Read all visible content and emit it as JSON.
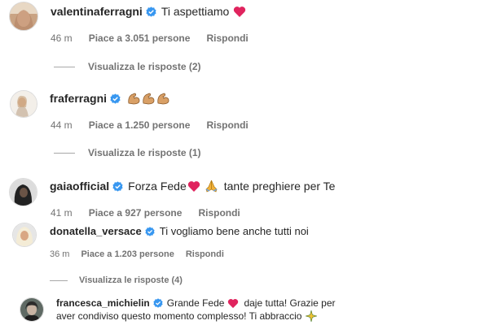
{
  "comments": [
    {
      "username": "valentinaferragni",
      "text": "Ti aspettiamo",
      "emojis_after": [
        "red-heart"
      ],
      "time": "46 m",
      "likes": "Piace a 3.051 persone",
      "reply": "Rispondi",
      "view_replies": "Visualizza le risposte (2)"
    },
    {
      "username": "fraferragni",
      "text": "",
      "emojis_after": [
        "flexed-biceps",
        "flexed-biceps",
        "flexed-biceps"
      ],
      "time": "44 m",
      "likes": "Piace a 1.250 persone",
      "reply": "Rispondi",
      "view_replies": "Visualizza le risposte (1)"
    },
    {
      "username": "gaiaofficial",
      "text_before": "Forza Fede",
      "text_after": "tante preghiere per Te",
      "emojis_mid": [
        "red-heart",
        "folded-hands"
      ],
      "time": "41 m",
      "likes": "Piace a 927 persone",
      "reply": "Rispondi"
    },
    {
      "username": "donatella_versace",
      "text": "Ti vogliamo bene anche tutti noi",
      "time": "36 m",
      "likes": "Piace a 1.203 persone",
      "reply": "Rispondi",
      "view_replies": "Visualizza le risposte (4)"
    },
    {
      "username": "francesca_michielin",
      "text_before": "Grande Fede",
      "text_after": "daje tutta! Grazie per",
      "text_line2": "aver condiviso questo momento complesso! Ti abbraccio",
      "emojis": [
        "red-heart",
        "sparkles"
      ]
    }
  ],
  "colors": {
    "verified": "#3897f0",
    "heart": "#e0245e",
    "meta": "#737373",
    "text": "#262626"
  }
}
